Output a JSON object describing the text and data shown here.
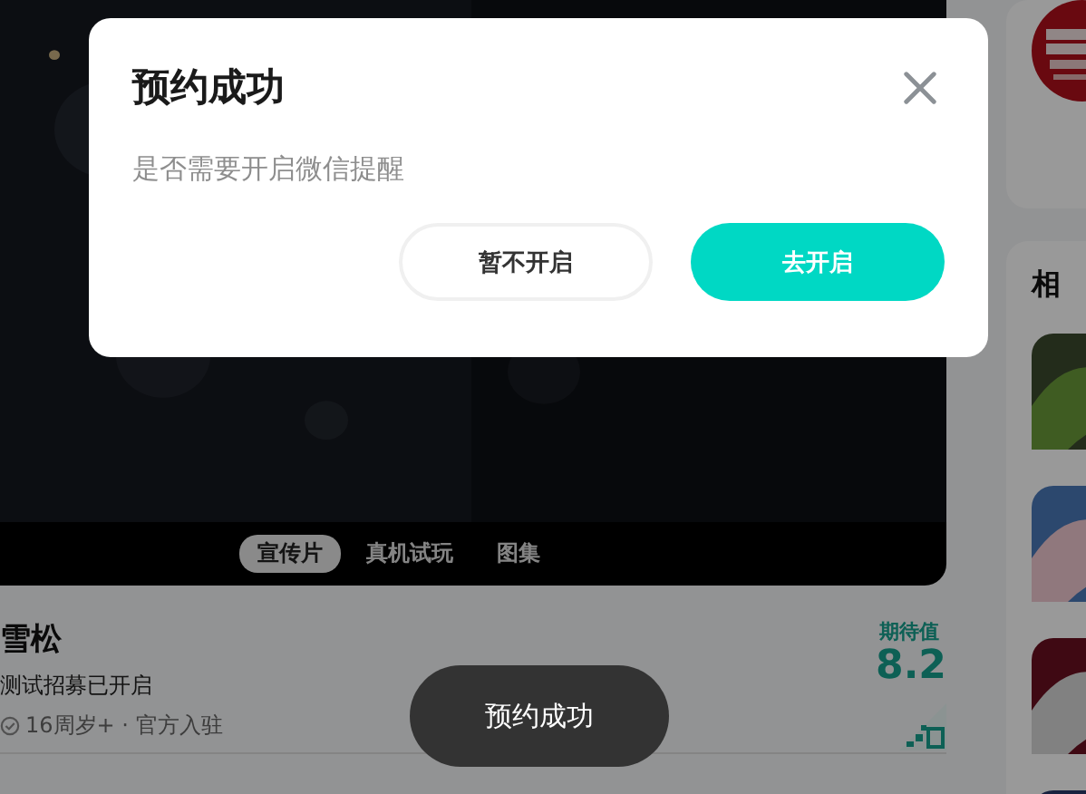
{
  "video": {
    "tabs": [
      {
        "label": "宣传片",
        "selected": true
      },
      {
        "label": "真机试玩",
        "selected": false
      },
      {
        "label": "图集",
        "selected": false
      }
    ]
  },
  "game": {
    "name": "雪松",
    "status": "测试招募已开启",
    "meta": "16周岁+ · 官方入驻",
    "rating_label": "期待值",
    "rating": "8.2"
  },
  "sidebar": {
    "related_title": "相"
  },
  "dialog": {
    "title": "预约成功",
    "message": "是否需要开启微信提醒",
    "buttons": [
      {
        "label": "暂不开启",
        "kind": "secondary"
      },
      {
        "label": "去开启",
        "kind": "primary"
      }
    ]
  },
  "toast": "预约成功"
}
